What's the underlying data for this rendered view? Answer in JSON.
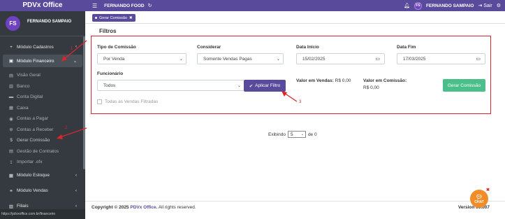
{
  "brand": {
    "name": "PDVx Office"
  },
  "user": {
    "initials": "FS",
    "name": "FERNANDO SAMPAIO"
  },
  "topbar": {
    "store": "FERNANDO FOOD",
    "user": "FERNANDO SAMPAIO",
    "logout": "Sair"
  },
  "sidebar": {
    "items": [
      {
        "label": "Módulo Cadastros",
        "icon": "plus-icon"
      },
      {
        "label": "Módulo Financeiro",
        "icon": "money-icon"
      },
      {
        "label": "Visão Geral",
        "icon": "file-icon"
      },
      {
        "label": "Banco",
        "icon": "bank-icon"
      },
      {
        "label": "Conta Digital",
        "icon": "wallet-icon"
      },
      {
        "label": "Caixa",
        "icon": "register-icon"
      },
      {
        "label": "Contas a Pagar",
        "icon": "pay-icon"
      },
      {
        "label": "Contas a Receber",
        "icon": "receive-icon"
      },
      {
        "label": "Gerar Comissão",
        "icon": "dollar-icon"
      },
      {
        "label": "Gestão de Contratos",
        "icon": "contract-icon"
      },
      {
        "label": "Importar .ofx",
        "icon": "upload-icon"
      },
      {
        "label": "Módulo Estoque",
        "icon": "box-icon"
      },
      {
        "label": "Módulo Vendas",
        "icon": "handshake-icon"
      },
      {
        "label": "Filiais",
        "icon": "building-icon"
      }
    ],
    "footer_text": "https://pdvxoffice.com.br/financeiro"
  },
  "tab": {
    "label": "Gerar Comissão"
  },
  "filters": {
    "title": "Filtros",
    "tipo_label": "Tipo de Comissão",
    "tipo_value": "Por Venda",
    "considerar_label": "Considerar",
    "considerar_value": "Somente Vendas Pagas",
    "data_inicio_label": "Data Início",
    "data_inicio_value": "15/02/2025",
    "data_fim_label": "Data Fim",
    "data_fim_value": "17/03/2025",
    "funcionario_label": "Funcionário",
    "funcionario_value": "Todos",
    "apply_label": "Aplicar Filtro",
    "valor_vendas_label": "Valor em Vendas:",
    "valor_vendas_value": "R$ 0,00",
    "valor_comissao_label": "Valor em Comissão:",
    "valor_comissao_value": "R$ 0,00",
    "gerar_label": "Gerar Comissão",
    "checkbox_label": "Todas as Vendas Filtradas"
  },
  "paging": {
    "prefix": "Exibindo",
    "value": "5",
    "suffix": "de 0"
  },
  "footer": {
    "copy_prefix": "Copyright © 2025",
    "brand": "PDVx Office.",
    "rights": "All rights reserved.",
    "version": "Version 00.007"
  },
  "chat": {
    "label": "CHAT"
  },
  "annotations": {
    "one": "1",
    "two": "2",
    "three": "3"
  },
  "colors": {
    "primary": "#5a4a9b",
    "accent_red": "#d9262c",
    "success": "#4bbf8a",
    "sidebar": "#343a40"
  }
}
